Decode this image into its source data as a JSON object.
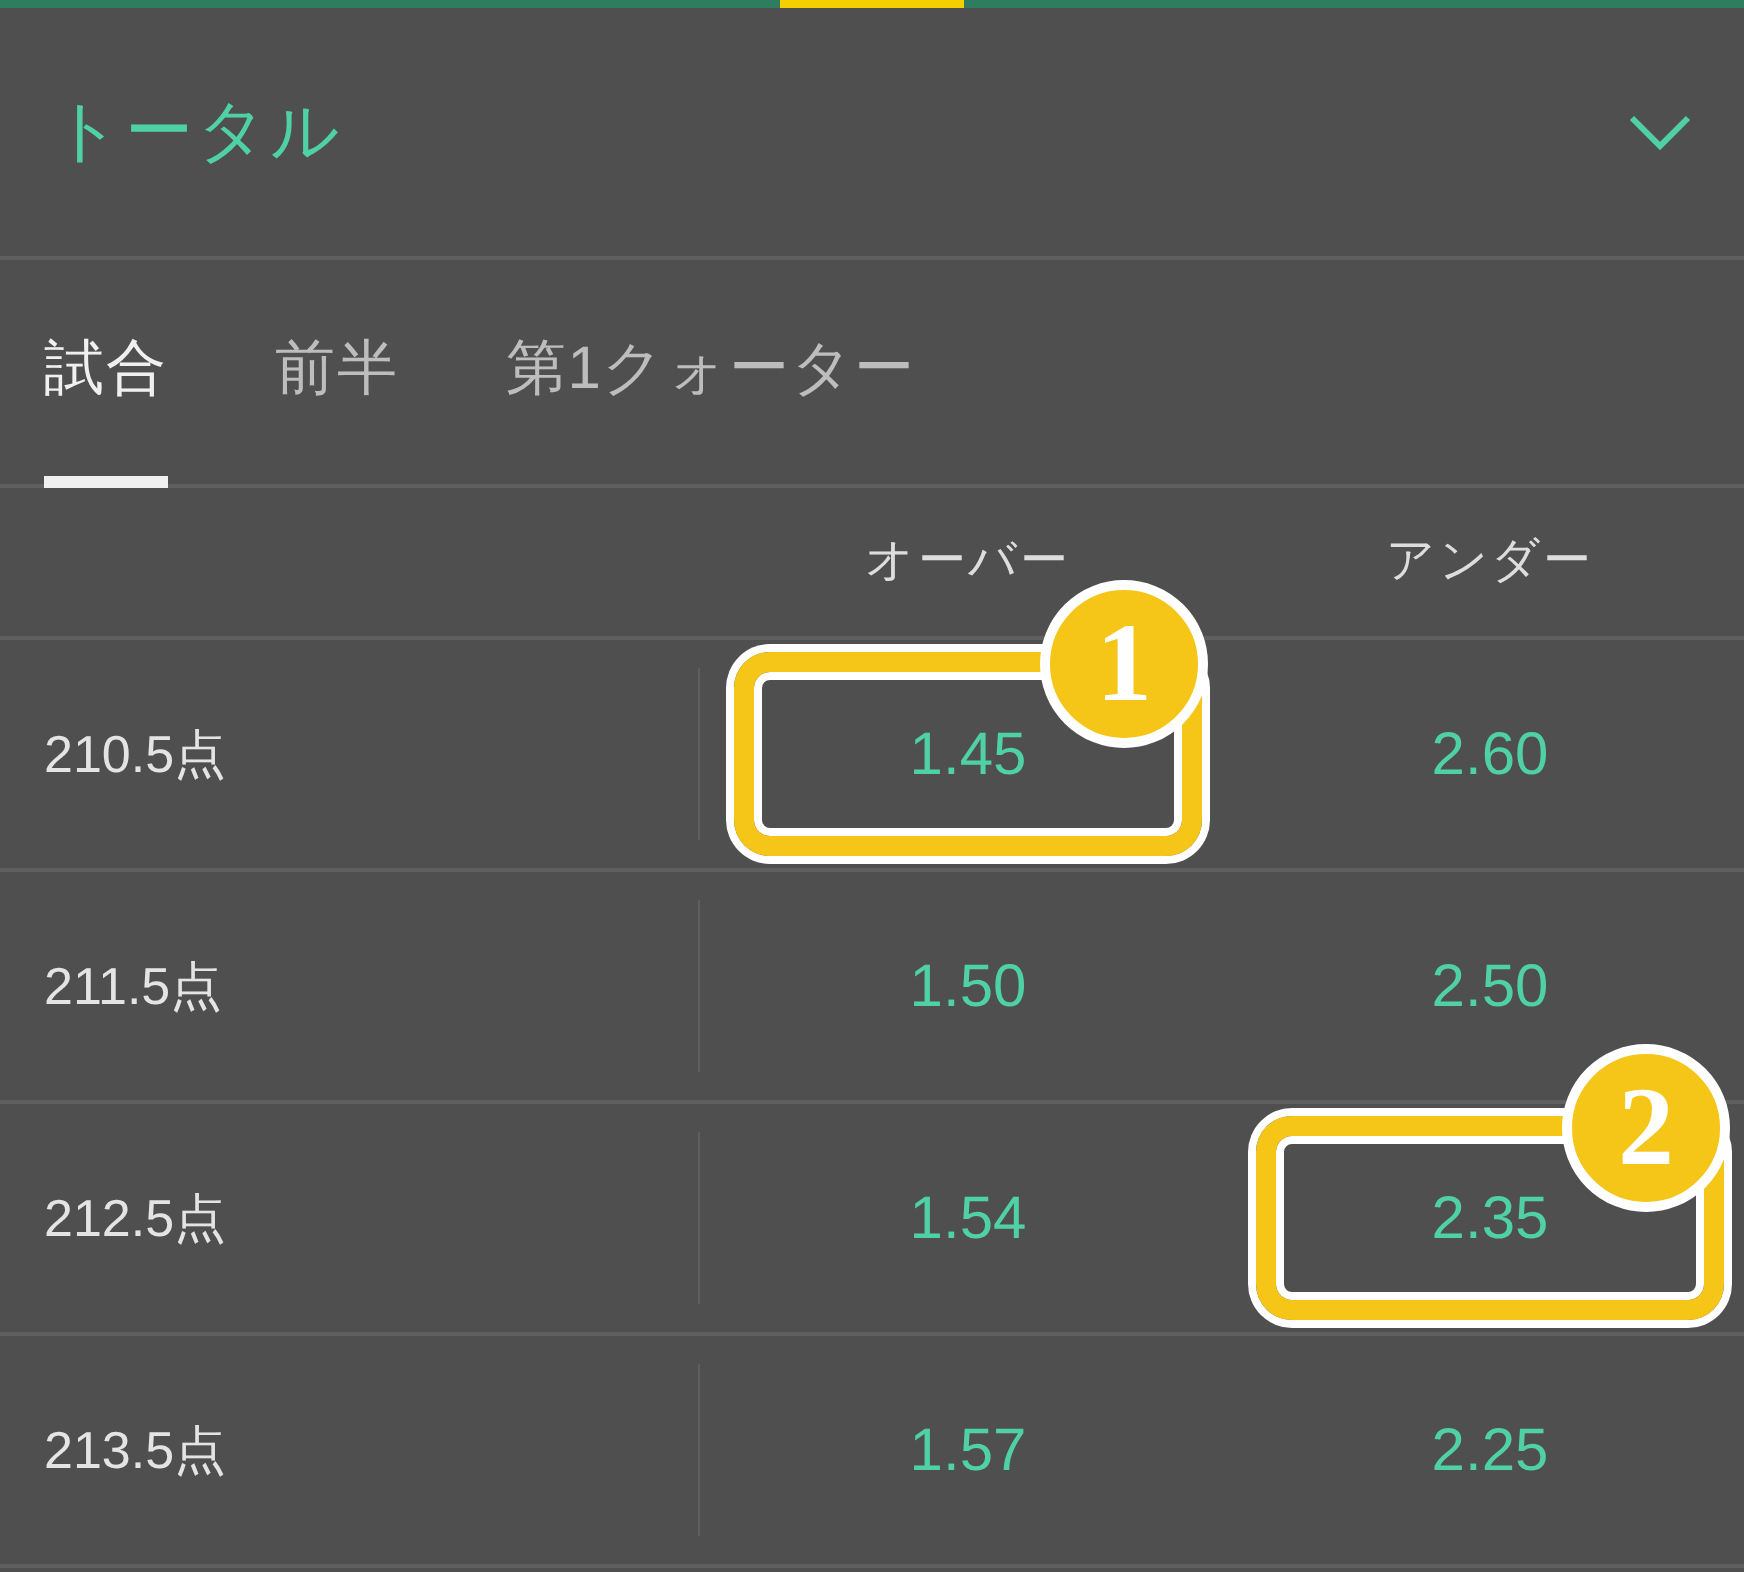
{
  "market": {
    "title": "トータル",
    "expanded": true
  },
  "tabs": [
    {
      "label": "試合",
      "selected": true
    },
    {
      "label": "前半",
      "selected": false
    },
    {
      "label": "第1クォーター",
      "selected": false
    }
  ],
  "columns": [
    "オーバー",
    "アンダー"
  ],
  "rows": [
    {
      "line": "210.5点",
      "over": {
        "odds": "1.45",
        "callout": "1"
      },
      "under": {
        "odds": "2.60"
      }
    },
    {
      "line": "211.5点",
      "over": {
        "odds": "1.50"
      },
      "under": {
        "odds": "2.50"
      }
    },
    {
      "line": "212.5点",
      "over": {
        "odds": "1.54"
      },
      "under": {
        "odds": "2.35",
        "callout": "2"
      }
    },
    {
      "line": "213.5点",
      "over": {
        "odds": "1.57"
      },
      "under": {
        "odds": "2.25"
      }
    }
  ]
}
